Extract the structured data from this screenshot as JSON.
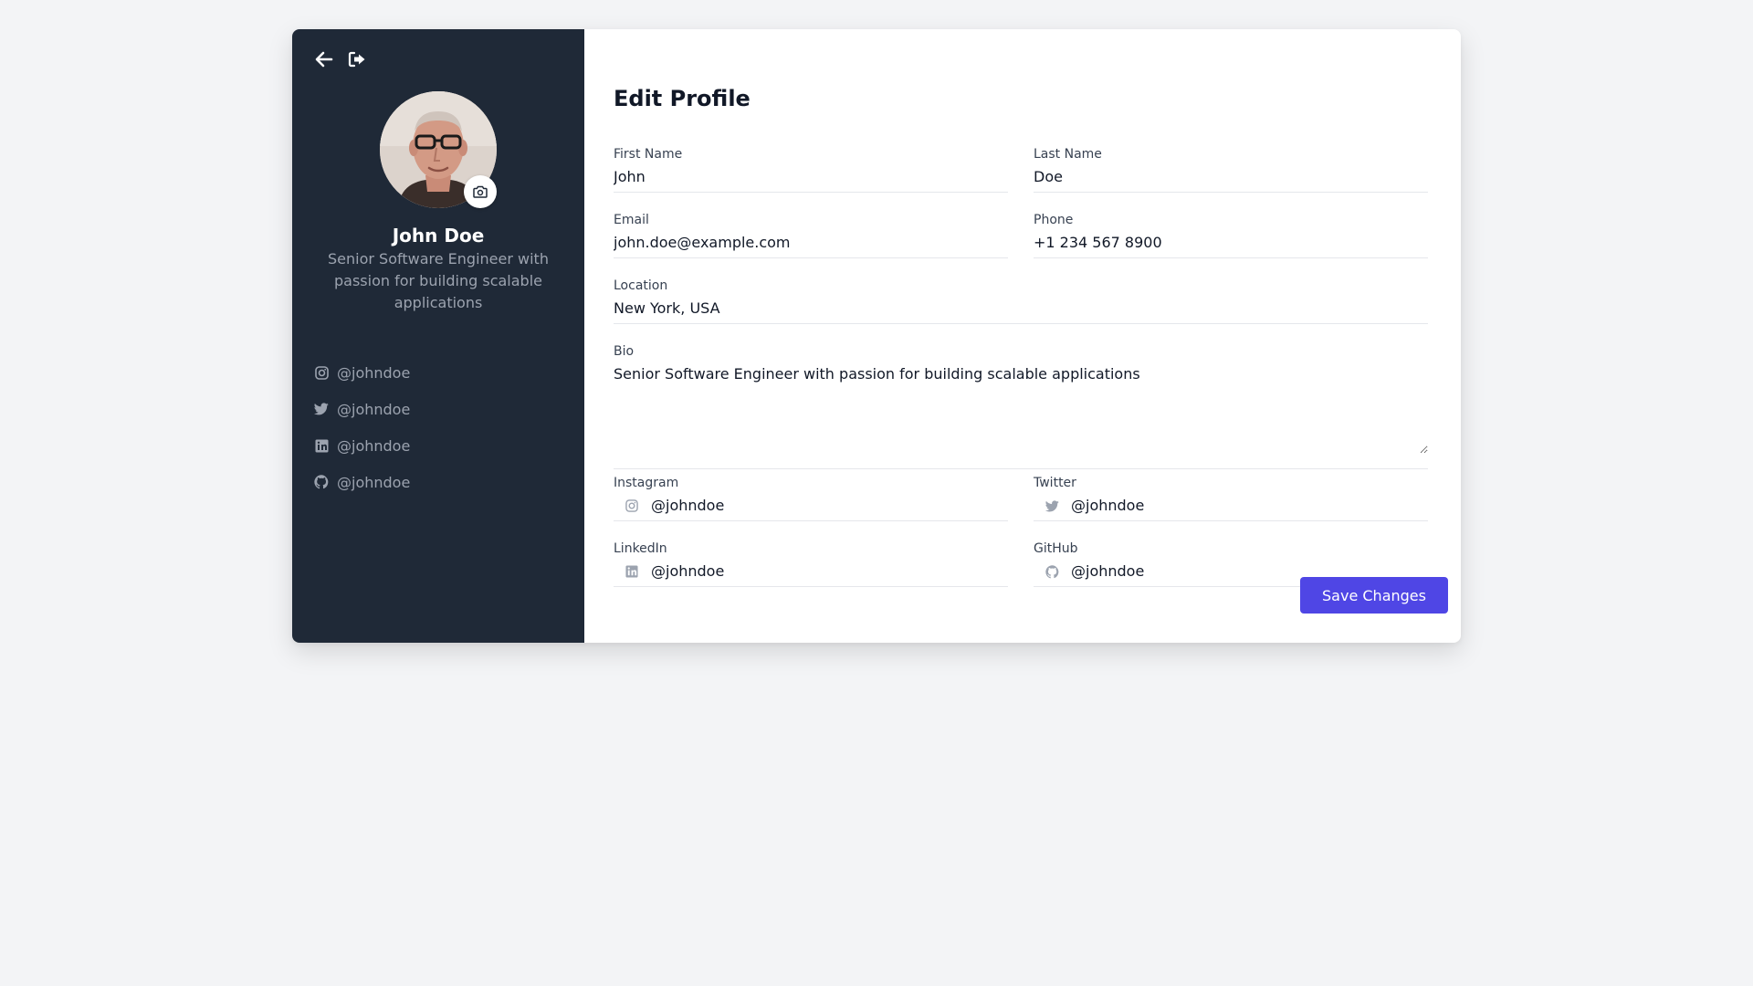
{
  "icons": {
    "back": "arrow-left-icon",
    "logout": "sign-out-icon",
    "camera": "camera-icon",
    "instagram": "instagram-icon",
    "twitter": "twitter-icon",
    "linkedin": "linkedin-icon",
    "github": "github-icon"
  },
  "colors": {
    "sidebar_bg": "#1f2937",
    "accent": "#4f46e5",
    "muted": "#9ca3af"
  },
  "sidebar": {
    "name": "John Doe",
    "bio": "Senior Software Engineer with passion for building scalable applications",
    "socials": [
      {
        "icon": "instagram-icon",
        "handle": "@johndoe"
      },
      {
        "icon": "twitter-icon",
        "handle": "@johndoe"
      },
      {
        "icon": "linkedin-icon",
        "handle": "@johndoe"
      },
      {
        "icon": "github-icon",
        "handle": "@johndoe"
      }
    ]
  },
  "form": {
    "title": "Edit Profile",
    "first_name": {
      "label": "First Name",
      "value": "John"
    },
    "last_name": {
      "label": "Last Name",
      "value": "Doe"
    },
    "email": {
      "label": "Email",
      "value": "john.doe@example.com"
    },
    "phone": {
      "label": "Phone",
      "value": "+1 234 567 8900"
    },
    "location": {
      "label": "Location",
      "value": "New York, USA"
    },
    "bio": {
      "label": "Bio",
      "value": "Senior Software Engineer with passion for building scalable applications"
    },
    "instagram": {
      "label": "Instagram",
      "value": "@johndoe"
    },
    "twitter": {
      "label": "Twitter",
      "value": "@johndoe"
    },
    "linkedin": {
      "label": "LinkedIn",
      "value": "@johndoe"
    },
    "github": {
      "label": "GitHub",
      "value": "@johndoe"
    },
    "save_label": "Save Changes"
  }
}
